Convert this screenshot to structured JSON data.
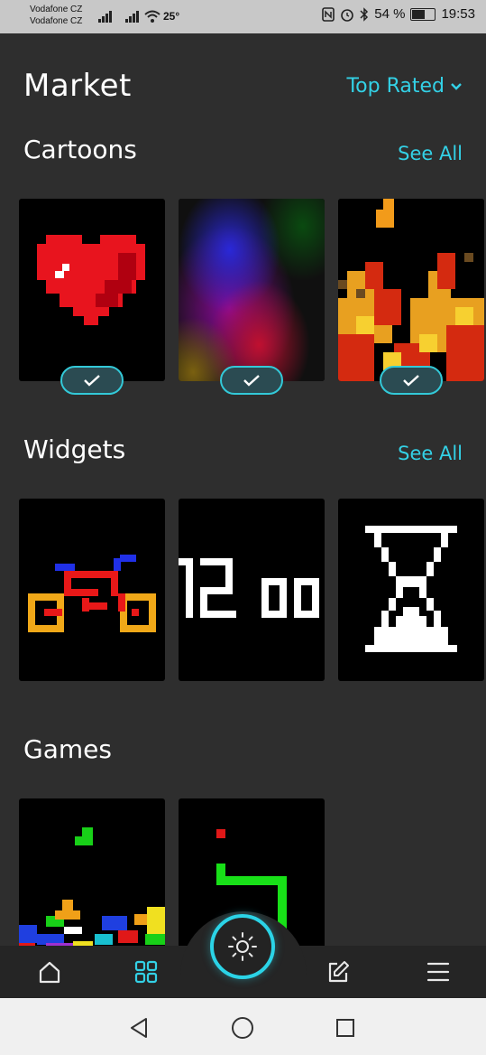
{
  "status": {
    "carrier1": "Vodafone CZ",
    "carrier2": "Vodafone CZ",
    "temperature": "25°",
    "battery": "54 %",
    "battery_level": 0.54,
    "time": "19:53"
  },
  "header": {
    "title": "Market",
    "sort_label": "Top Rated"
  },
  "sections": {
    "cartoons": {
      "title": "Cartoons",
      "see_all": "See All"
    },
    "widgets": {
      "title": "Widgets",
      "see_all": "See All"
    },
    "games": {
      "title": "Games"
    }
  },
  "cards": {
    "cartoons": [
      {
        "name": "heart",
        "installed": true
      },
      {
        "name": "blurry-lights",
        "installed": true
      },
      {
        "name": "fire",
        "installed": true
      }
    ],
    "widgets": [
      {
        "name": "bicycle"
      },
      {
        "name": "clock",
        "text": "12 00"
      },
      {
        "name": "hourglass"
      }
    ],
    "games": [
      {
        "name": "tetris"
      },
      {
        "name": "snake"
      }
    ]
  },
  "tabs": [
    "home-icon",
    "grid-icon",
    "brightness-icon",
    "edit-icon",
    "menu-icon"
  ],
  "accent_color": "#33d1e6"
}
